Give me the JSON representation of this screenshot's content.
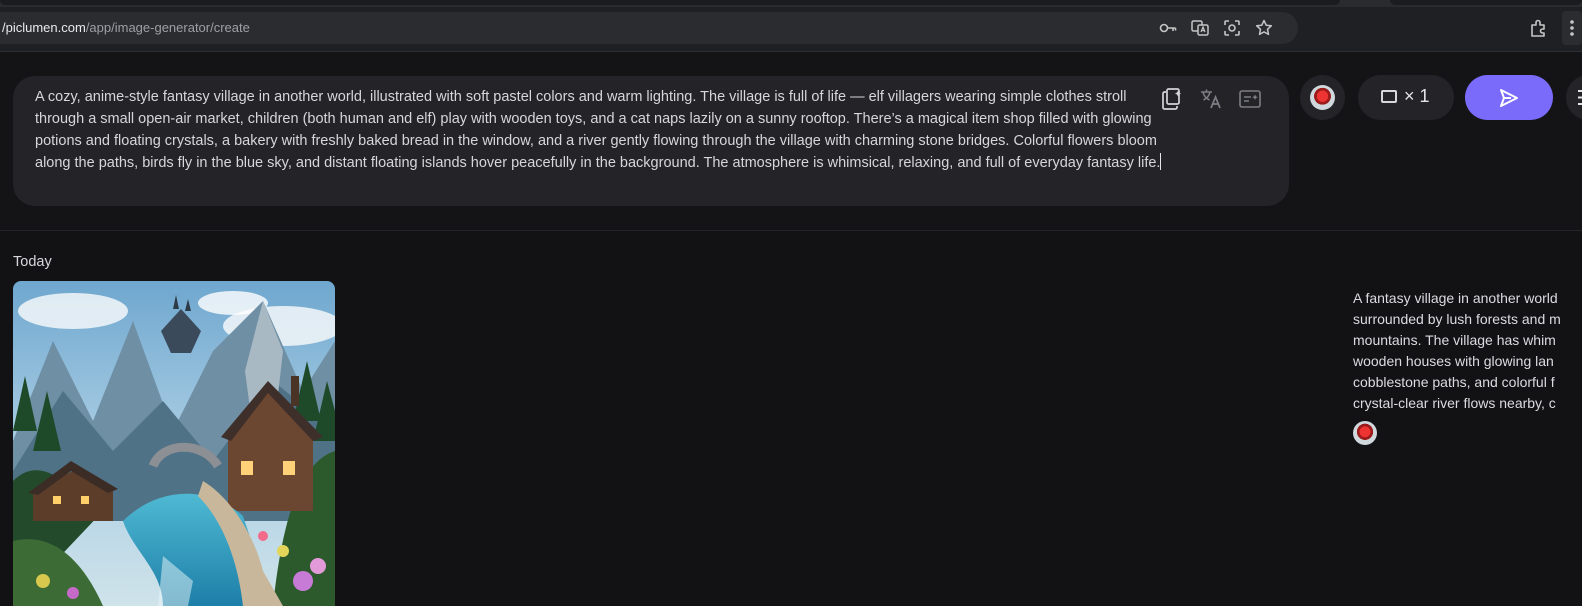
{
  "browser": {
    "url_prefix": "/",
    "url_host": "/piclumen.com",
    "url_path": "/app/image-generator/create",
    "icons": [
      "key-icon",
      "translate-icon",
      "lens-icon",
      "star-icon",
      "extensions-icon",
      "more-icon"
    ]
  },
  "prompt": {
    "text": "A cozy, anime-style fantasy village in another world, illustrated with soft pastel colors and warm lighting. The village is full of life — elf villagers wearing simple clothes stroll through a small open-air market, children (both human and elf) play with wooden toys, and a cat naps lazily on a sunny rooftop. There’s a magical item shop filled with glowing potions and floating crystals, a bakery with freshly baked bread in the window, and a river gently flowing through the village with charming stone bridges. Colorful flowers bloom along the paths, birds fly in the blue sky, and distant floating islands hover peacefully in the background. The atmosphere is whimsical, relaxing, and full of everyday fantasy life."
  },
  "controls": {
    "count_label": "× 1",
    "accent": "#7b6bfb"
  },
  "history": {
    "group_label": "Today",
    "side_lines": [
      "A fantasy village in another world",
      "surrounded by lush forests and m",
      "mountains. The village has whim",
      "wooden houses with glowing lan",
      "cobblestone paths, and colorful f",
      "crystal-clear river flows nearby, c"
    ]
  }
}
